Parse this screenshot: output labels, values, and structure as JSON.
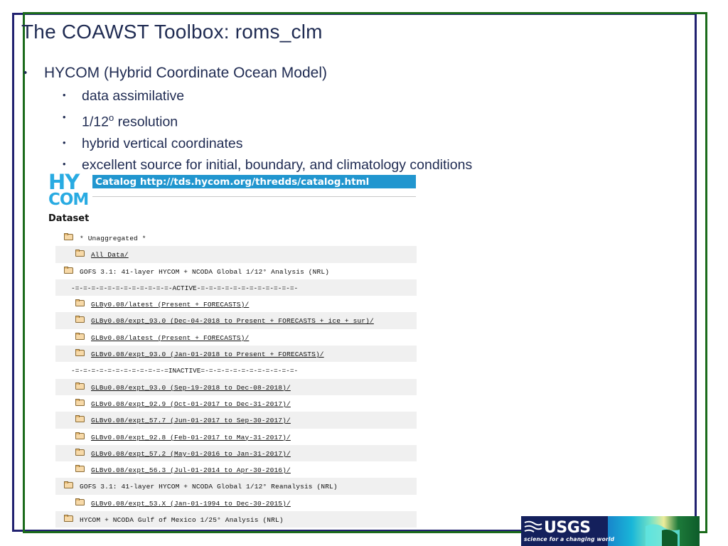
{
  "slide": {
    "title": "The COAWST Toolbox: roms_clm",
    "frame_colors": {
      "inner_border": "#212170",
      "outer_border": "#1b6b1b",
      "title_color": "#1f2b52"
    }
  },
  "bullets": {
    "main": "HYCOM (Hybrid Coordinate Ocean Model)",
    "sub": [
      {
        "prefix": "data assimilative",
        "degree": "",
        "suffix": ""
      },
      {
        "prefix": "1/12",
        "degree": "o",
        "suffix": " resolution"
      },
      {
        "prefix": "hybrid vertical coordinates",
        "degree": "",
        "suffix": ""
      },
      {
        "prefix": "excellent source for initial, boundary, and climatology conditions",
        "degree": "",
        "suffix": ""
      }
    ]
  },
  "catalog": {
    "logo_line1": "HY",
    "logo_line2": "COM",
    "logo_color": "#29abe2",
    "dataset_label": "Dataset",
    "bar_color": "#2196cf",
    "bar_text": "Catalog http://tds.hycom.org/thredds/catalog.html",
    "rows": [
      {
        "indent": 1,
        "folder": true,
        "link": false,
        "text": "* Unaggregated *"
      },
      {
        "indent": 2,
        "folder": true,
        "link": true,
        "text": "All Data/"
      },
      {
        "indent": 1,
        "folder": true,
        "link": false,
        "text": "GOFS 3.1: 41-layer HYCOM + NCODA Global 1/12° Analysis (NRL)"
      },
      {
        "indent": 2,
        "folder": false,
        "link": false,
        "text": "-=-=-=-=-=-=-=-=-=-=-=-=-ACTIVE-=-=-=-=-=-=-=-=-=-=-=-=-"
      },
      {
        "indent": 2,
        "folder": true,
        "link": true,
        "text": "GLBy0.08/latest (Present + FORECASTS)/"
      },
      {
        "indent": 2,
        "folder": true,
        "link": true,
        "text": "GLBy0.08/expt_93.0 (Dec-04-2018 to Present + FORECASTS + ice + sur)/"
      },
      {
        "indent": 2,
        "folder": true,
        "link": true,
        "text": "GLBv0.08/latest (Present + FORECASTS)/"
      },
      {
        "indent": 2,
        "folder": true,
        "link": true,
        "text": "GLBv0.08/expt_93.0 (Jan-01-2018 to Present + FORECASTS)/"
      },
      {
        "indent": 2,
        "folder": false,
        "link": false,
        "text": "-=-=-=-=-=-=-=-=-=-=-=-=INACTIVE=-=-=-=-=-=-=-=-=-=-=-=-"
      },
      {
        "indent": 2,
        "folder": true,
        "link": true,
        "text": "GLBu0.08/expt_93.0 (Sep-19-2018 to Dec-08-2018)/"
      },
      {
        "indent": 2,
        "folder": true,
        "link": true,
        "text": "GLBv0.08/expt_92.9 (Oct-01-2017 to Dec-31-2017)/"
      },
      {
        "indent": 2,
        "folder": true,
        "link": true,
        "text": "GLBv0.08/expt_57.7 (Jun-01-2017 to Sep-30-2017)/"
      },
      {
        "indent": 2,
        "folder": true,
        "link": true,
        "text": "GLBv0.08/expt_92.8 (Feb-01-2017 to May-31-2017)/"
      },
      {
        "indent": 2,
        "folder": true,
        "link": true,
        "text": "GLBv0.08/expt_57.2 (May-01-2016 to Jan-31-2017)/"
      },
      {
        "indent": 2,
        "folder": true,
        "link": true,
        "text": "GLBv0.08/expt_56.3 (Jul-01-2014 to Apr-30-2016)/"
      },
      {
        "indent": 1,
        "folder": true,
        "link": false,
        "text": "GOFS 3.1: 41-layer HYCOM + NCODA Global 1/12° Reanalysis (NRL)"
      },
      {
        "indent": 2,
        "folder": true,
        "link": true,
        "text": "GLBv0.08/expt_53.X (Jan-01-1994 to Dec-30-2015)/"
      },
      {
        "indent": 1,
        "folder": true,
        "link": false,
        "text": "HYCOM + NCODA Gulf of Mexico 1/25° Analysis (NRL)"
      }
    ]
  },
  "usgs": {
    "wordmark": "USGS",
    "tagline": "science for a changing world",
    "background": "#14205c"
  }
}
